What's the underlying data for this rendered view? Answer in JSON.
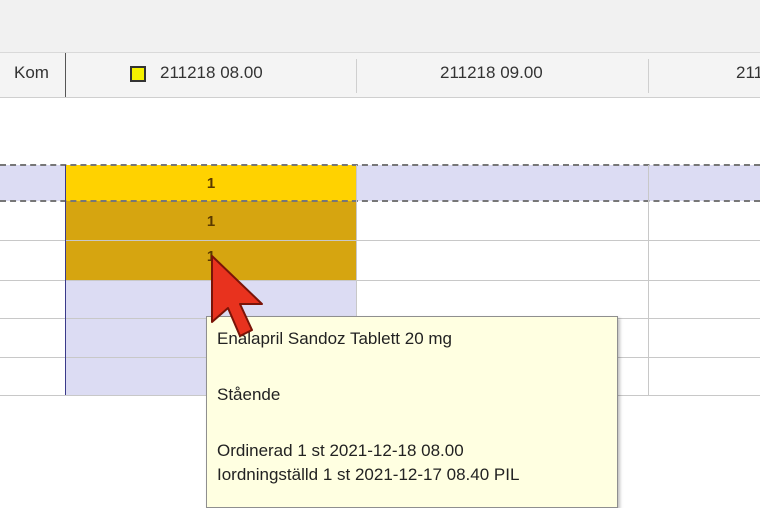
{
  "header": {
    "col_kom": "Kom",
    "col1": "211218 08.00",
    "col2": "211218 09.00",
    "col3": "211"
  },
  "grid": {
    "marks": [
      "1",
      "1",
      "1"
    ],
    "colors": {
      "row_bg": "#d9d9f2",
      "selected_bright": "#ffd200",
      "selected_dark": "#d6a510"
    }
  },
  "tooltip": {
    "title": "Enalapril Sandoz Tablett 20 mg",
    "position": "Stående",
    "ordered": "Ordinerad 1 st  2021-12-18 08.00",
    "prepared": "Iordningställd 1 st 2021-12-17 08.40 PIL"
  },
  "cursor_icon": "arrow-cursor-icon"
}
